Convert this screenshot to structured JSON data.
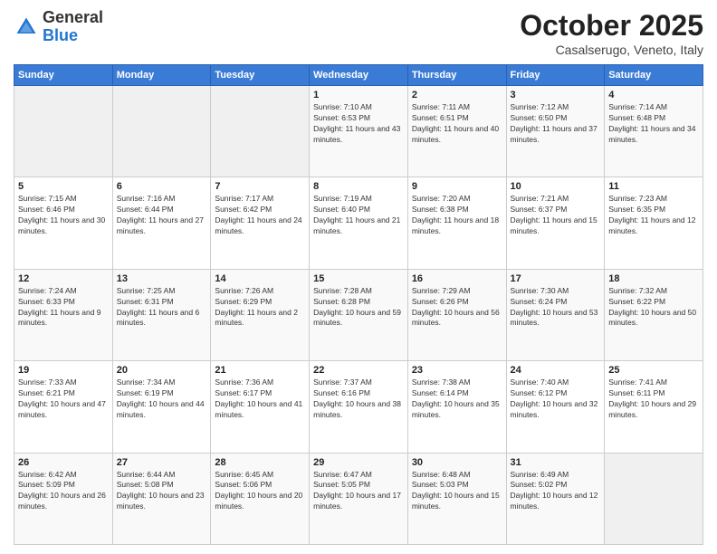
{
  "header": {
    "logo": {
      "general": "General",
      "blue": "Blue"
    },
    "month": "October 2025",
    "location": "Casalserugo, Veneto, Italy"
  },
  "weekdays": [
    "Sunday",
    "Monday",
    "Tuesday",
    "Wednesday",
    "Thursday",
    "Friday",
    "Saturday"
  ],
  "weeks": [
    [
      null,
      null,
      null,
      {
        "day": "1",
        "sunrise": "7:10 AM",
        "sunset": "6:53 PM",
        "daylight": "11 hours and 43 minutes."
      },
      {
        "day": "2",
        "sunrise": "7:11 AM",
        "sunset": "6:51 PM",
        "daylight": "11 hours and 40 minutes."
      },
      {
        "day": "3",
        "sunrise": "7:12 AM",
        "sunset": "6:50 PM",
        "daylight": "11 hours and 37 minutes."
      },
      {
        "day": "4",
        "sunrise": "7:14 AM",
        "sunset": "6:48 PM",
        "daylight": "11 hours and 34 minutes."
      }
    ],
    [
      {
        "day": "5",
        "sunrise": "7:15 AM",
        "sunset": "6:46 PM",
        "daylight": "11 hours and 30 minutes."
      },
      {
        "day": "6",
        "sunrise": "7:16 AM",
        "sunset": "6:44 PM",
        "daylight": "11 hours and 27 minutes."
      },
      {
        "day": "7",
        "sunrise": "7:17 AM",
        "sunset": "6:42 PM",
        "daylight": "11 hours and 24 minutes."
      },
      {
        "day": "8",
        "sunrise": "7:19 AM",
        "sunset": "6:40 PM",
        "daylight": "11 hours and 21 minutes."
      },
      {
        "day": "9",
        "sunrise": "7:20 AM",
        "sunset": "6:38 PM",
        "daylight": "11 hours and 18 minutes."
      },
      {
        "day": "10",
        "sunrise": "7:21 AM",
        "sunset": "6:37 PM",
        "daylight": "11 hours and 15 minutes."
      },
      {
        "day": "11",
        "sunrise": "7:23 AM",
        "sunset": "6:35 PM",
        "daylight": "11 hours and 12 minutes."
      }
    ],
    [
      {
        "day": "12",
        "sunrise": "7:24 AM",
        "sunset": "6:33 PM",
        "daylight": "11 hours and 9 minutes."
      },
      {
        "day": "13",
        "sunrise": "7:25 AM",
        "sunset": "6:31 PM",
        "daylight": "11 hours and 6 minutes."
      },
      {
        "day": "14",
        "sunrise": "7:26 AM",
        "sunset": "6:29 PM",
        "daylight": "11 hours and 2 minutes."
      },
      {
        "day": "15",
        "sunrise": "7:28 AM",
        "sunset": "6:28 PM",
        "daylight": "10 hours and 59 minutes."
      },
      {
        "day": "16",
        "sunrise": "7:29 AM",
        "sunset": "6:26 PM",
        "daylight": "10 hours and 56 minutes."
      },
      {
        "day": "17",
        "sunrise": "7:30 AM",
        "sunset": "6:24 PM",
        "daylight": "10 hours and 53 minutes."
      },
      {
        "day": "18",
        "sunrise": "7:32 AM",
        "sunset": "6:22 PM",
        "daylight": "10 hours and 50 minutes."
      }
    ],
    [
      {
        "day": "19",
        "sunrise": "7:33 AM",
        "sunset": "6:21 PM",
        "daylight": "10 hours and 47 minutes."
      },
      {
        "day": "20",
        "sunrise": "7:34 AM",
        "sunset": "6:19 PM",
        "daylight": "10 hours and 44 minutes."
      },
      {
        "day": "21",
        "sunrise": "7:36 AM",
        "sunset": "6:17 PM",
        "daylight": "10 hours and 41 minutes."
      },
      {
        "day": "22",
        "sunrise": "7:37 AM",
        "sunset": "6:16 PM",
        "daylight": "10 hours and 38 minutes."
      },
      {
        "day": "23",
        "sunrise": "7:38 AM",
        "sunset": "6:14 PM",
        "daylight": "10 hours and 35 minutes."
      },
      {
        "day": "24",
        "sunrise": "7:40 AM",
        "sunset": "6:12 PM",
        "daylight": "10 hours and 32 minutes."
      },
      {
        "day": "25",
        "sunrise": "7:41 AM",
        "sunset": "6:11 PM",
        "daylight": "10 hours and 29 minutes."
      }
    ],
    [
      {
        "day": "26",
        "sunrise": "6:42 AM",
        "sunset": "5:09 PM",
        "daylight": "10 hours and 26 minutes."
      },
      {
        "day": "27",
        "sunrise": "6:44 AM",
        "sunset": "5:08 PM",
        "daylight": "10 hours and 23 minutes."
      },
      {
        "day": "28",
        "sunrise": "6:45 AM",
        "sunset": "5:06 PM",
        "daylight": "10 hours and 20 minutes."
      },
      {
        "day": "29",
        "sunrise": "6:47 AM",
        "sunset": "5:05 PM",
        "daylight": "10 hours and 17 minutes."
      },
      {
        "day": "30",
        "sunrise": "6:48 AM",
        "sunset": "5:03 PM",
        "daylight": "10 hours and 15 minutes."
      },
      {
        "day": "31",
        "sunrise": "6:49 AM",
        "sunset": "5:02 PM",
        "daylight": "10 hours and 12 minutes."
      },
      null
    ]
  ],
  "labels": {
    "sunrise": "Sunrise:",
    "sunset": "Sunset:",
    "daylight": "Daylight:"
  }
}
